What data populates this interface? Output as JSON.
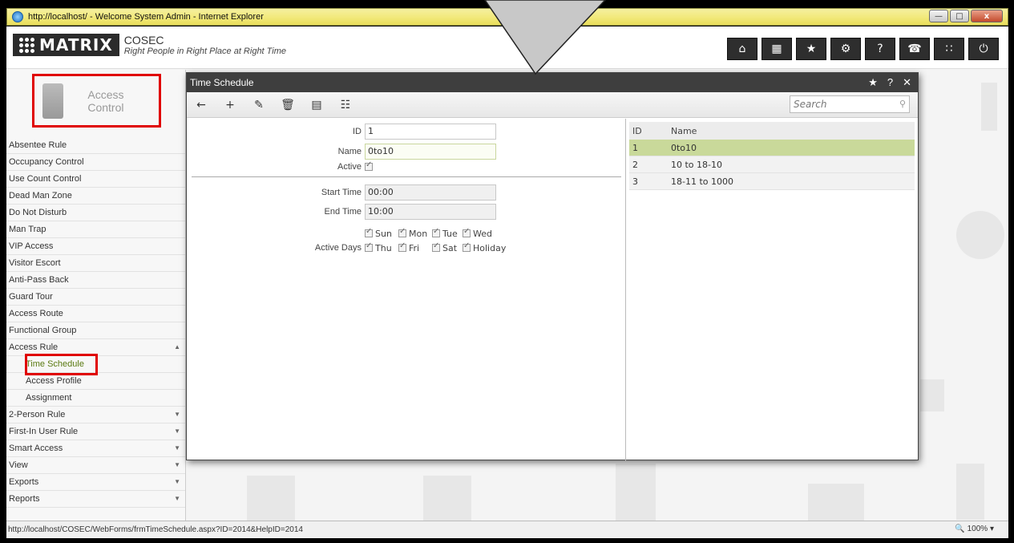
{
  "browser": {
    "title": "http://localhost/ - Welcome System Admin - Internet Explorer",
    "status_url": "http://localhost/COSEC/WebForms/frmTimeSchedule.aspx?ID=2014&HelpID=2014",
    "zoom": "100%"
  },
  "header": {
    "brand": "MATRIX",
    "product": "COSEC",
    "tagline": "Right People in Right Place at Right Time",
    "icons": [
      "home-icon",
      "grid-icon",
      "star-icon",
      "gear-icon",
      "help-icon",
      "phone-icon",
      "modules-icon",
      "power-icon"
    ]
  },
  "sidebar": {
    "module_title": "Access Control",
    "items": [
      {
        "label": "Absentee Rule"
      },
      {
        "label": "Occupancy Control"
      },
      {
        "label": "Use Count Control"
      },
      {
        "label": "Dead Man Zone"
      },
      {
        "label": "Do Not Disturb"
      },
      {
        "label": "Man Trap"
      },
      {
        "label": "VIP Access"
      },
      {
        "label": "Visitor Escort"
      },
      {
        "label": "Anti-Pass Back"
      },
      {
        "label": "Guard Tour"
      },
      {
        "label": "Access Route"
      },
      {
        "label": "Functional Group"
      },
      {
        "label": "Access Rule"
      },
      {
        "label": "Time Schedule"
      },
      {
        "label": "Access Profile"
      },
      {
        "label": "Assignment"
      },
      {
        "label": "2-Person Rule"
      },
      {
        "label": "First-In User Rule"
      },
      {
        "label": "Smart Access"
      },
      {
        "label": "View"
      },
      {
        "label": "Exports"
      },
      {
        "label": "Reports"
      }
    ]
  },
  "dialog": {
    "title": "Time Schedule",
    "search_placeholder": "Search",
    "form": {
      "id_label": "ID",
      "id_value": "1",
      "name_label": "Name",
      "name_value": "0to10",
      "active_label": "Active",
      "start_label": "Start Time",
      "start_value": "00:00",
      "end_label": "End Time",
      "end_value": "10:00",
      "days_label": "Active Days",
      "days": [
        "Sun",
        "Mon",
        "Tue",
        "Wed",
        "Thu",
        "Fri",
        "Sat",
        "Holiday"
      ]
    },
    "grid": {
      "headers": {
        "id": "ID",
        "name": "Name"
      },
      "rows": [
        {
          "id": "1",
          "name": "0to10"
        },
        {
          "id": "2",
          "name": "10 to 18-10"
        },
        {
          "id": "3",
          "name": "18-11 to 1000"
        }
      ]
    }
  }
}
